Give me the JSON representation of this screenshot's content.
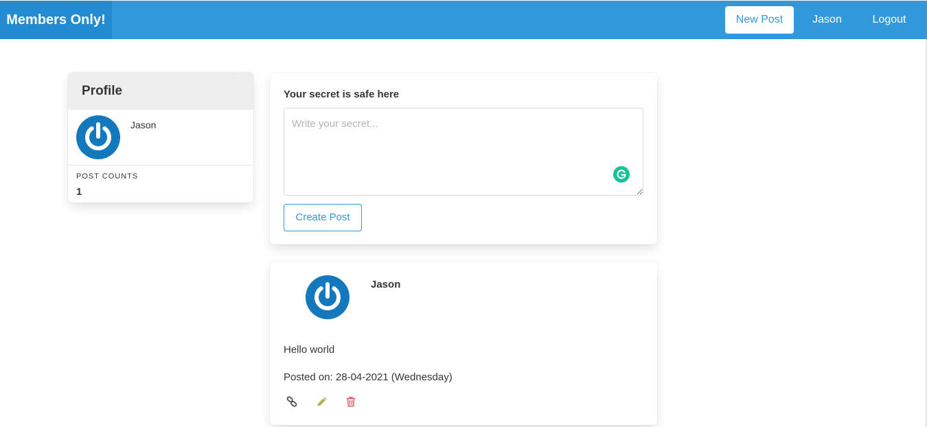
{
  "navbar": {
    "brand": "Members Only!",
    "new_post": "New Post",
    "user": "Jason",
    "logout": "Logout"
  },
  "profile": {
    "title": "Profile",
    "name": "Jason",
    "post_counts_label": "POST COUNTS",
    "post_counts_value": "1",
    "avatar_icon": "power-icon"
  },
  "form": {
    "label": "Your secret is safe here",
    "placeholder": "Write your secret...",
    "value": "",
    "submit_label": "Create Post"
  },
  "post": {
    "author": "Jason",
    "body": "Hello world",
    "date": "Posted on: 28-04-2021 (Wednesday)",
    "actions": [
      "link-icon",
      "edit-icon",
      "delete-icon"
    ]
  },
  "colors": {
    "navbar": "#3298dc",
    "brand": "#238cd1",
    "avatar_blue": "#1479bc",
    "edit_icon": "#b5b44a",
    "delete_icon": "#e0545e",
    "grammarly": "#15c39a"
  }
}
